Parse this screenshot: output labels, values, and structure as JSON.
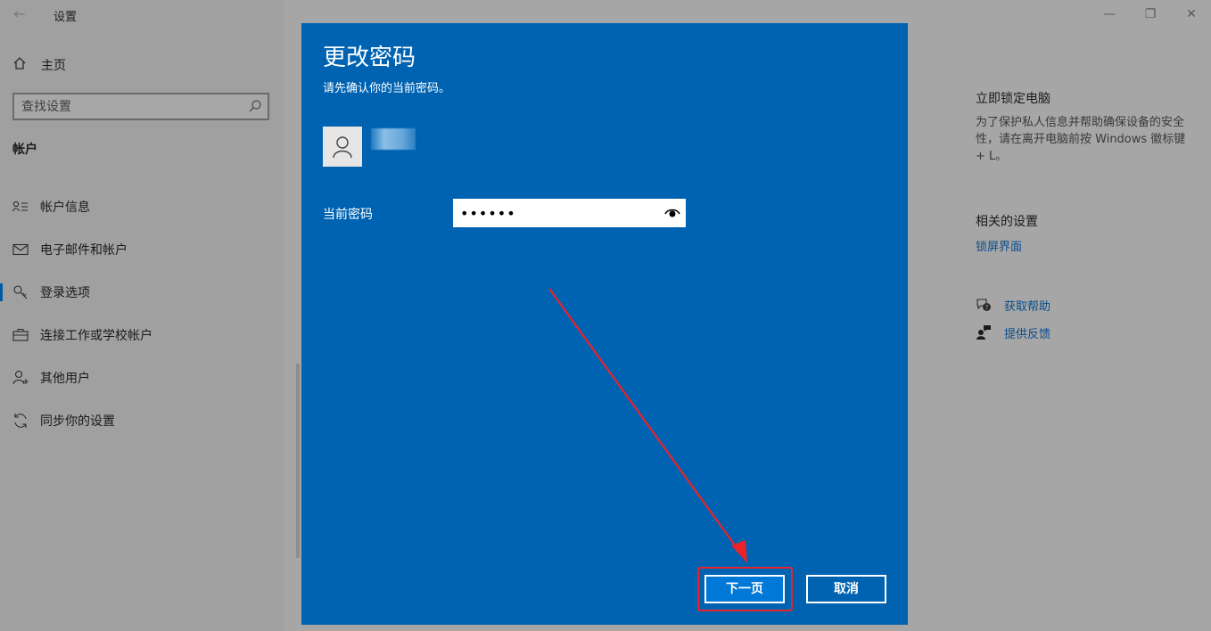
{
  "window": {
    "title": "设置",
    "back_icon": "back-arrow-icon",
    "minimize_icon": "minimize-icon",
    "restore_icon": "restore-icon",
    "close_icon": "close-icon"
  },
  "sidebar": {
    "home_label": "主页",
    "search_placeholder": "查找设置",
    "section_title": "帐户",
    "items": [
      {
        "label": "帐户信息",
        "icon": "account-info-icon",
        "active": false
      },
      {
        "label": "电子邮件和帐户",
        "icon": "mail-icon",
        "active": false
      },
      {
        "label": "登录选项",
        "icon": "key-icon",
        "active": true
      },
      {
        "label": "连接工作或学校帐户",
        "icon": "briefcase-icon",
        "active": false
      },
      {
        "label": "其他用户",
        "icon": "add-person-icon",
        "active": false
      },
      {
        "label": "同步你的设置",
        "icon": "sync-icon",
        "active": false
      }
    ]
  },
  "side_panel": {
    "lock_title": "立即锁定电脑",
    "lock_desc": "为了保护私人信息并帮助确保设备的安全性，请在离开电脑前按 Windows 徽标键 + L。",
    "related_title": "相关的设置",
    "related_link": "锁屏界面",
    "help_label": "获取帮助",
    "feedback_label": "提供反馈"
  },
  "dialog": {
    "title": "更改密码",
    "subtitle": "请先确认你的当前密码。",
    "user_name": "",
    "password_label": "当前密码",
    "password_value": "••••••",
    "next_button": "下一页",
    "cancel_button": "取消"
  },
  "colors": {
    "dialog_bg": "#0063b1",
    "next_button_bg": "#0078d7",
    "annotation_red": "#e8232a",
    "link": "#0b4d8c"
  }
}
